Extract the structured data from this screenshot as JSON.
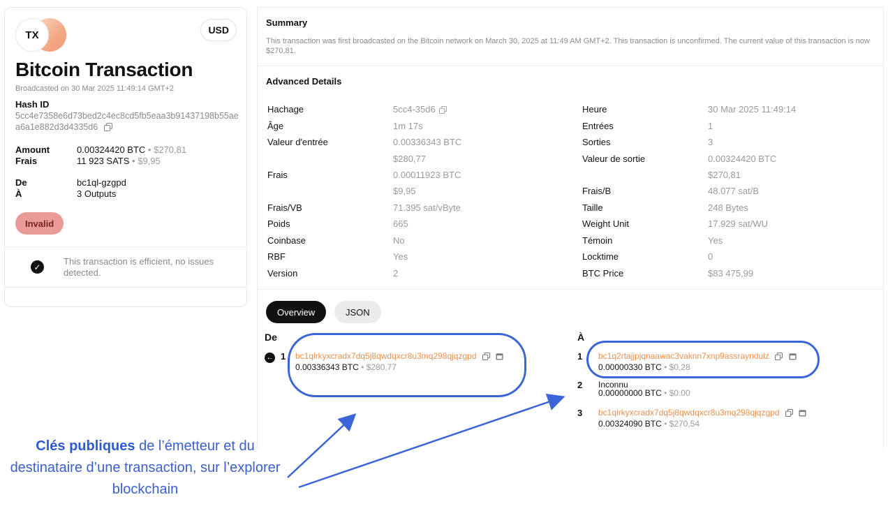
{
  "card": {
    "badge": "TX",
    "currency": "USD",
    "title": "Bitcoin Transaction",
    "broadcast": "Broadcasted on 30 Mar 2025 11:49:14 GMT+2",
    "hash_label": "Hash ID",
    "hash_value": "5cc4e7358e6d73bed2c4ec8cd5fb5eaa3b91437198b55aea6a1e882d3d4335d6",
    "amount_label": "Amount",
    "amount_btc": "0.00324420 BTC",
    "amount_usd": "$270,81",
    "fee_label": "Frais",
    "fee_sats": "11 923 SATS",
    "fee_usd": "$9,95",
    "from_label": "De",
    "from_value": "bc1ql-gzgpd",
    "to_label": "À",
    "to_value": "3 Outputs",
    "status": "Invalid",
    "efficiency_msg": "This transaction is efficient, no issues detected.",
    "dot": "•"
  },
  "summary": {
    "title": "Summary",
    "text": "This transaction was first broadcasted on the Bitcoin network on March 30, 2025 at 11:49 AM GMT+2. This transaction is unconfirmed. The current value of this transaction is now $270,81."
  },
  "advanced": {
    "title": "Advanced Details",
    "left": [
      {
        "label": "Hachage",
        "value": "5cc4-35d6"
      },
      {
        "label": "Âge",
        "value": "1m 17s"
      },
      {
        "label": "Valeur d'entrée",
        "value": "0.00336343 BTC"
      },
      {
        "label": "",
        "value": "$280,77"
      },
      {
        "label": "Frais",
        "value": "0.00011923 BTC"
      },
      {
        "label": "",
        "value": "$9,95"
      },
      {
        "label": "Frais/VB",
        "value": "71.395 sat/vByte"
      },
      {
        "label": "Poids",
        "value": "665"
      },
      {
        "label": "Coinbase",
        "value": "No"
      },
      {
        "label": "RBF",
        "value": "Yes"
      },
      {
        "label": "Version",
        "value": "2"
      }
    ],
    "right": [
      {
        "label": "Heure",
        "value": "30 Mar 2025 11:49:14"
      },
      {
        "label": "Entrées",
        "value": "1"
      },
      {
        "label": "Sorties",
        "value": "3"
      },
      {
        "label": "Valeur de sortie",
        "value": "0.00324420 BTC"
      },
      {
        "label": "",
        "value": "$270,81"
      },
      {
        "label": "Frais/B",
        "value": "48.077 sat/B"
      },
      {
        "label": "Taille",
        "value": "248 Bytes"
      },
      {
        "label": "Weight Unit",
        "value": "17.929 sat/WU"
      },
      {
        "label": "Témoin",
        "value": "Yes"
      },
      {
        "label": "Locktime",
        "value": "0"
      },
      {
        "label": "BTC Price",
        "value": "$83 475,99"
      }
    ]
  },
  "tabs": {
    "overview": "Overview",
    "json": "JSON"
  },
  "io": {
    "from_head": "De",
    "to_head": "À",
    "inputs": [
      {
        "num": "1",
        "address": "bc1qlrkyxcradx7dq5j8qwdqxcr8u3mq298qjqzgpd",
        "btc": "0.00336343 BTC",
        "usd": "$280,77"
      }
    ],
    "outputs": [
      {
        "num": "1",
        "address": "bc1q2rtajjpjqnaawac3vaknn7xnp9assrayndulz",
        "btc": "0.00000330 BTC",
        "usd": "$0,28"
      },
      {
        "num": "2",
        "label": "Inconnu",
        "btc": "0.00000000 BTC",
        "usd": "$0.00"
      },
      {
        "num": "3",
        "address": "bc1qlrkyxcradx7dq5j8qwdqxcr8u3mq298qjqzgpd",
        "btc": "0.00324090 BTC",
        "usd": "$270,54"
      }
    ]
  },
  "caption": {
    "bold": "Clés publiques",
    "rest": " de l’émetteur et du destinataire d’une transaction, sur l’explorer blockchain"
  },
  "colors": {
    "accent_orange": "#e8914f",
    "annotation_blue": "#3a64d8",
    "invalid_bg": "#e99b97"
  }
}
